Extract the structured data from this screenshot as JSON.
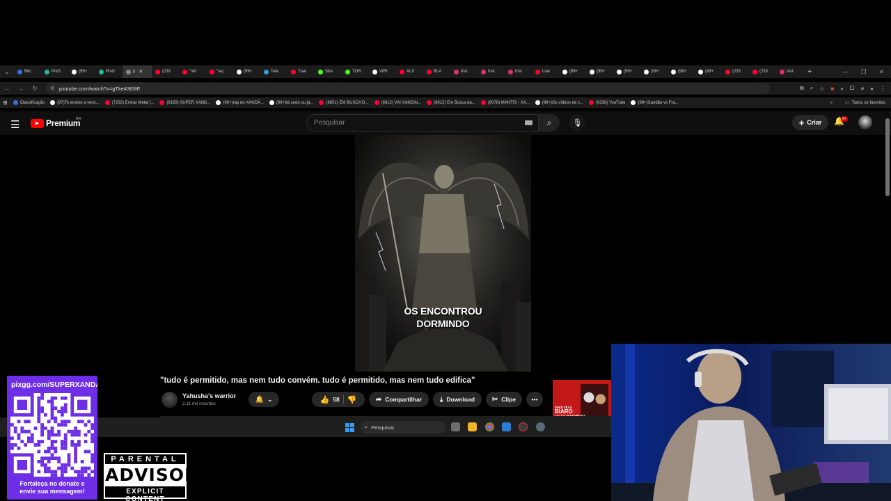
{
  "browser": {
    "tabs": [
      {
        "label": "Bitc",
        "color": "#3b6fe0"
      },
      {
        "label": "PixG",
        "color": "#2bb3a0"
      },
      {
        "label": "(99+",
        "color": "#ffffff"
      },
      {
        "label": "PixG",
        "color": "#2bb3a0"
      },
      {
        "label": "p",
        "color": "#888888",
        "active": true
      },
      {
        "label": "(233",
        "color": "#ff0033"
      },
      {
        "label": "\"mil",
        "color": "#ff0033"
      },
      {
        "label": "\"sej",
        "color": "#ff0033"
      },
      {
        "label": "(99+",
        "color": "#ffffff"
      },
      {
        "label": "Tele",
        "color": "#2aa3e0"
      },
      {
        "label": "Tran",
        "color": "#ff0033"
      },
      {
        "label": "Stre",
        "color": "#53fc18"
      },
      {
        "label": "TOR",
        "color": "#53fc18"
      },
      {
        "label": "VIRI",
        "color": "#ffffff"
      },
      {
        "label": "ALII",
        "color": "#ff0033"
      },
      {
        "label": "BLA",
        "color": "#ff0033"
      },
      {
        "label": "Inst",
        "color": "#e1306c"
      },
      {
        "label": "Inst",
        "color": "#e1306c"
      },
      {
        "label": "Inst",
        "color": "#e1306c"
      },
      {
        "label": "Low",
        "color": "#ff0033"
      },
      {
        "label": "(99+",
        "color": "#ffffff"
      },
      {
        "label": "(99+",
        "color": "#ffffff"
      },
      {
        "label": "(99+",
        "color": "#ffffff"
      },
      {
        "label": "(99+",
        "color": "#ffffff"
      },
      {
        "label": "(99+",
        "color": "#ffffff"
      },
      {
        "label": "(99+",
        "color": "#ffffff"
      },
      {
        "label": "(233",
        "color": "#ff0033"
      },
      {
        "label": "(233",
        "color": "#ff0033"
      },
      {
        "label": "Inst",
        "color": "#e1306c"
      }
    ],
    "url": "youtube.com/watch?v=gTke43tSliE",
    "bookmarks": [
      {
        "label": "Classificação",
        "color": "#3b6fe0"
      },
      {
        "label": "(97)Te ensino a venc...",
        "color": "#ffffff"
      },
      {
        "label": "(7292) Enéas Metal |...",
        "color": "#ff0033"
      },
      {
        "label": "(8159) SUPER XAND...",
        "color": "#ff0033"
      },
      {
        "label": "(99+)rap do XANDÃ...",
        "color": "#ffffff"
      },
      {
        "label": "(99+)tá cedo ou já...",
        "color": "#ffffff"
      },
      {
        "label": "(8851) EM BUSCA D...",
        "color": "#ff0033"
      },
      {
        "label": "(8912) VAI XANDIN...",
        "color": "#ff0033"
      },
      {
        "label": "(8912) Em Busca da...",
        "color": "#ff0033"
      },
      {
        "label": "(9078) MANTIS - XA...",
        "color": "#ff0033"
      },
      {
        "label": "(99+)Os vídeos de c...",
        "color": "#ffffff"
      },
      {
        "label": "(9338) YouTube",
        "color": "#ff0033"
      },
      {
        "label": "(99+)Xandão vs Fra...",
        "color": "#ffffff"
      }
    ],
    "all_bookmarks_label": "Todos os favoritos"
  },
  "youtube": {
    "logo_text": "Premium",
    "country": "BR",
    "search_placeholder": "Pesquisar",
    "create_label": "Criar",
    "notifications_badge": "9+",
    "video_caption_line1": "OS ENCONTROU",
    "video_caption_line2": "DORMINDO",
    "title": "\"tudo é permitido, mas nem tudo convém. tudo é permitido, mas nem tudo edifica\"",
    "channel_name": "Yahusha's warrior",
    "channel_subs": "2,11 mil inscritos",
    "likes": "58",
    "share_label": "Compartilhar",
    "download_label": "Download",
    "clip_label": "Clipe",
    "ad_thumb_text_line1": "você viu o",
    "ad_thumb_text_line2": "BIARO",
    "ad_thumb_text_line3": "em EX-MACHINA?"
  },
  "taskbar": {
    "search_label": "Pesquisar"
  },
  "overlay": {
    "donate_url": "pixgg.com/SUPERXANDAO",
    "donate_text_line1": "Fortaleça no donate e",
    "donate_text_line2": "envie sua mensagem!",
    "advisory_top": "PARENTAL",
    "advisory_mid": "ADVISORY",
    "advisory_bottom": "EXPLICIT CONTENT"
  }
}
